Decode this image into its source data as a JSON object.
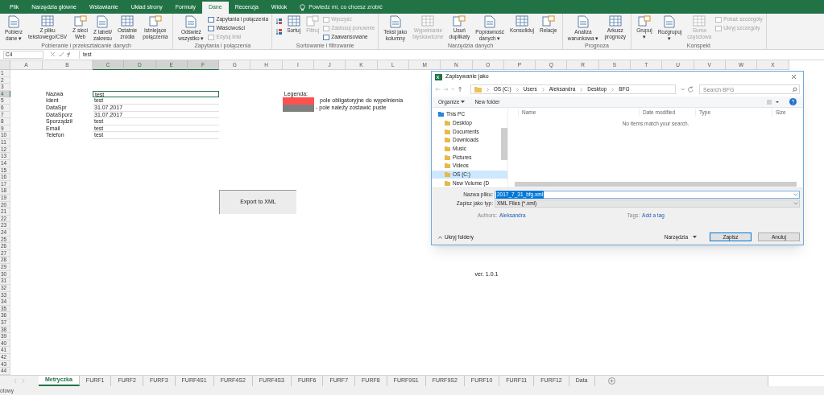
{
  "ribbon_tabs": [
    {
      "label": "Plik",
      "selected": false
    },
    {
      "label": "Narzędzia główne",
      "selected": false
    },
    {
      "label": "Wstawianie",
      "selected": false
    },
    {
      "label": "Układ strony",
      "selected": false
    },
    {
      "label": "Formuły",
      "selected": false
    },
    {
      "label": "Dane",
      "selected": true
    },
    {
      "label": "Recenzja",
      "selected": false
    },
    {
      "label": "Widok",
      "selected": false
    }
  ],
  "tell_me": "Powiedz mi, co chcesz zrobić",
  "ribbon_groups": [
    {
      "label": "Pobieranie i przekształcanie danych",
      "items": [
        {
          "kind": "large",
          "lines": [
            "Pobierz",
            "dane ▾"
          ],
          "disabled": false
        },
        {
          "kind": "large",
          "lines": [
            "Z pliku",
            "tekstowego/CSV"
          ],
          "disabled": false
        },
        {
          "kind": "large",
          "lines": [
            "Z sieci",
            "Web"
          ],
          "disabled": false
        },
        {
          "kind": "large",
          "lines": [
            "Z tabeli/",
            "zakresu"
          ],
          "disabled": false
        },
        {
          "kind": "large",
          "lines": [
            "Ostatnie",
            "źródła"
          ],
          "disabled": false
        },
        {
          "kind": "large",
          "lines": [
            "Istniejące",
            "połączenia"
          ],
          "disabled": false
        }
      ]
    },
    {
      "label": "Zapytania i połączenia",
      "items": [
        {
          "kind": "large",
          "lines": [
            "Odśwież",
            "wszystko ▾"
          ],
          "disabled": false
        },
        {
          "kind": "small-stack",
          "items": [
            {
              "label": "Zapytania i połączenia",
              "disabled": false
            },
            {
              "label": "Właściwości",
              "disabled": false
            },
            {
              "label": "Edytuj linki",
              "disabled": true
            }
          ]
        }
      ]
    },
    {
      "label": "Sortowanie i filtrowanie",
      "items": [
        {
          "kind": "sort-pair"
        },
        {
          "kind": "large",
          "lines": [
            "Sortuj"
          ],
          "disabled": false
        },
        {
          "kind": "large",
          "lines": [
            "Filtruj"
          ],
          "disabled": true
        },
        {
          "kind": "small-stack",
          "items": [
            {
              "label": "Wyczyść",
              "disabled": true
            },
            {
              "label": "Zastosuj ponownie",
              "disabled": true
            },
            {
              "label": "Zaawansowane",
              "disabled": false
            }
          ]
        }
      ]
    },
    {
      "label": "Narzędzia danych",
      "items": [
        {
          "kind": "large",
          "lines": [
            "Tekst jako",
            "kolumny"
          ],
          "disabled": false
        },
        {
          "kind": "large",
          "lines": [
            "Wypełnianie",
            "błyskawiczne"
          ],
          "disabled": true
        },
        {
          "kind": "large",
          "lines": [
            "Usuń",
            "duplikaty"
          ],
          "disabled": false
        },
        {
          "kind": "large",
          "lines": [
            "Poprawność",
            "danych ▾"
          ],
          "disabled": false
        },
        {
          "kind": "large",
          "lines": [
            "Konsoliduj"
          ],
          "disabled": false
        },
        {
          "kind": "large",
          "lines": [
            "Relacje"
          ],
          "disabled": false
        }
      ]
    },
    {
      "label": "Prognoza",
      "items": [
        {
          "kind": "large",
          "lines": [
            "Analiza",
            "warunkowa ▾"
          ],
          "disabled": false
        },
        {
          "kind": "large",
          "lines": [
            "Arkusz",
            "prognozy"
          ],
          "disabled": false
        }
      ]
    },
    {
      "label": "Konspekt",
      "items": [
        {
          "kind": "large",
          "lines": [
            "Grupuj",
            "▾"
          ],
          "disabled": false
        },
        {
          "kind": "large",
          "lines": [
            "Rozgrupuj",
            "▾"
          ],
          "disabled": false
        },
        {
          "kind": "large",
          "lines": [
            "Suma",
            "częściowa"
          ],
          "disabled": true
        },
        {
          "kind": "small-stack",
          "items": [
            {
              "label": "Pokaż szczegóły",
              "disabled": true
            },
            {
              "label": "Ukryj szczegóły",
              "disabled": true
            }
          ]
        }
      ]
    }
  ],
  "name_box": "C4",
  "formula": "test",
  "columns": [
    {
      "label": "A",
      "selected": false
    },
    {
      "label": "B",
      "selected": false
    },
    {
      "label": "C",
      "selected": true
    },
    {
      "label": "D",
      "selected": true
    },
    {
      "label": "E",
      "selected": true
    },
    {
      "label": "F",
      "selected": true
    },
    {
      "label": "G",
      "selected": false
    },
    {
      "label": "H",
      "selected": false
    },
    {
      "label": "I",
      "selected": false
    },
    {
      "label": "J",
      "selected": false
    },
    {
      "label": "K",
      "selected": false
    },
    {
      "label": "L",
      "selected": false
    },
    {
      "label": "M",
      "selected": false
    },
    {
      "label": "N",
      "selected": false
    },
    {
      "label": "O",
      "selected": false
    },
    {
      "label": "P",
      "selected": false
    },
    {
      "label": "Q",
      "selected": false
    },
    {
      "label": "R",
      "selected": false
    },
    {
      "label": "S",
      "selected": false
    },
    {
      "label": "T",
      "selected": false
    },
    {
      "label": "U",
      "selected": false
    },
    {
      "label": "V",
      "selected": false
    },
    {
      "label": "W",
      "selected": false
    },
    {
      "label": "X",
      "selected": false
    }
  ],
  "rows": [
    {
      "label": "1",
      "selected": false
    },
    {
      "label": "2",
      "selected": false
    },
    {
      "label": "3",
      "selected": false
    },
    {
      "label": "4",
      "selected": true
    },
    {
      "label": "5",
      "selected": false
    },
    {
      "label": "6",
      "selected": false
    },
    {
      "label": "7",
      "selected": false
    },
    {
      "label": "8",
      "selected": false
    },
    {
      "label": "9",
      "selected": false
    },
    {
      "label": "10",
      "selected": false
    },
    {
      "label": "11",
      "selected": false
    },
    {
      "label": "12",
      "selected": false
    },
    {
      "label": "13",
      "selected": false
    },
    {
      "label": "14",
      "selected": false
    },
    {
      "label": "15",
      "selected": false
    },
    {
      "label": "16",
      "selected": false
    },
    {
      "label": "17",
      "selected": false
    },
    {
      "label": "18",
      "selected": false
    },
    {
      "label": "19",
      "selected": false
    },
    {
      "label": "20",
      "selected": false
    },
    {
      "label": "21",
      "selected": false
    },
    {
      "label": "22",
      "selected": false
    },
    {
      "label": "23",
      "selected": false
    },
    {
      "label": "24",
      "selected": false
    },
    {
      "label": "25",
      "selected": false
    },
    {
      "label": "26",
      "selected": false
    },
    {
      "label": "27",
      "selected": false
    },
    {
      "label": "28",
      "selected": false
    },
    {
      "label": "29",
      "selected": false
    },
    {
      "label": "30",
      "selected": false
    },
    {
      "label": "31",
      "selected": false
    },
    {
      "label": "32",
      "selected": false
    },
    {
      "label": "33",
      "selected": false
    },
    {
      "label": "34",
      "selected": false
    },
    {
      "label": "35",
      "selected": false
    },
    {
      "label": "36",
      "selected": false
    },
    {
      "label": "37",
      "selected": false
    },
    {
      "label": "38",
      "selected": false
    },
    {
      "label": "39",
      "selected": false
    },
    {
      "label": "40",
      "selected": false
    },
    {
      "label": "41",
      "selected": false
    },
    {
      "label": "42",
      "selected": false
    },
    {
      "label": "43",
      "selected": false
    },
    {
      "label": "44",
      "selected": false
    }
  ],
  "form_fields": [
    {
      "label": "Nazwa",
      "value": "test",
      "selected": true
    },
    {
      "label": "Ident",
      "value": "test",
      "selected": false
    },
    {
      "label": "DataSpr",
      "value": "31.07.2017",
      "selected": false
    },
    {
      "label": "DataSporz",
      "value": "31.07.2017",
      "selected": false
    },
    {
      "label": "Sporządził",
      "value": "test",
      "selected": false
    },
    {
      "label": "Email",
      "value": "test",
      "selected": false
    },
    {
      "label": "Telefon",
      "value": "test",
      "selected": false
    }
  ],
  "legend": {
    "title": "Legenda:",
    "items": [
      {
        "color": "#ff5050",
        "text": "pole obligatoryjne do wypełnienia"
      },
      {
        "color": "#7f7f7f",
        "text": "- pole należy zostawić puste"
      }
    ]
  },
  "export_button": "Export to XML",
  "version": "ver. 1.0.1",
  "sheet_tabs": [
    {
      "label": "Metryczka",
      "selected": true
    },
    {
      "label": "FURF1",
      "selected": false
    },
    {
      "label": "FURF2",
      "selected": false
    },
    {
      "label": "FURF3",
      "selected": false
    },
    {
      "label": "FURF4S1",
      "selected": false
    },
    {
      "label": "FURF4S2",
      "selected": false
    },
    {
      "label": "FURF4S3",
      "selected": false
    },
    {
      "label": "FURF6",
      "selected": false
    },
    {
      "label": "FURF7",
      "selected": false
    },
    {
      "label": "FURF8",
      "selected": false
    },
    {
      "label": "FURF9S1",
      "selected": false
    },
    {
      "label": "FURF9S2",
      "selected": false
    },
    {
      "label": "FURF10",
      "selected": false
    },
    {
      "label": "FURF11",
      "selected": false
    },
    {
      "label": "FURF12",
      "selected": false
    },
    {
      "label": "Data",
      "selected": false
    }
  ],
  "status": "otowy",
  "save_dialog": {
    "title": "Zapisywanie jako",
    "breadcrumb": [
      "OS (C:)",
      "Users",
      "Aleksandra",
      "Desktop",
      "BFG"
    ],
    "search_placeholder": "Search BFG",
    "toolbar": [
      "Organize",
      "New folder"
    ],
    "nav_tree": [
      {
        "label": "This PC",
        "selected": false,
        "children": [
          {
            "label": "Desktop",
            "selected": false
          },
          {
            "label": "Documents",
            "selected": false
          },
          {
            "label": "Downloads",
            "selected": false
          },
          {
            "label": "Music",
            "selected": false
          },
          {
            "label": "Pictures",
            "selected": false
          },
          {
            "label": "Videos",
            "selected": false
          },
          {
            "label": "OS (C:)",
            "selected": true
          },
          {
            "label": "New Volume (D",
            "selected": false
          }
        ]
      }
    ],
    "columns": [
      "Name",
      "Date modified",
      "Type",
      "Size"
    ],
    "empty_message": "No items match your search.",
    "fields": [
      {
        "label": "Nazwa pliku:",
        "value": "2017_7_31_bfg.xml"
      },
      {
        "label": "Zapisz jako typ:",
        "value": "XML Files (*.xml)"
      }
    ],
    "meta": [
      {
        "label": "Authors:",
        "value": "Aleksandra"
      },
      {
        "label": "Tags:",
        "value": "Add a tag"
      }
    ],
    "hide_folders": "Ukryj foldery",
    "tools": "Narzędzia",
    "buttons": [
      {
        "label": "Zapisz",
        "default": true
      },
      {
        "label": "Anuluj",
        "default": false
      }
    ]
  }
}
